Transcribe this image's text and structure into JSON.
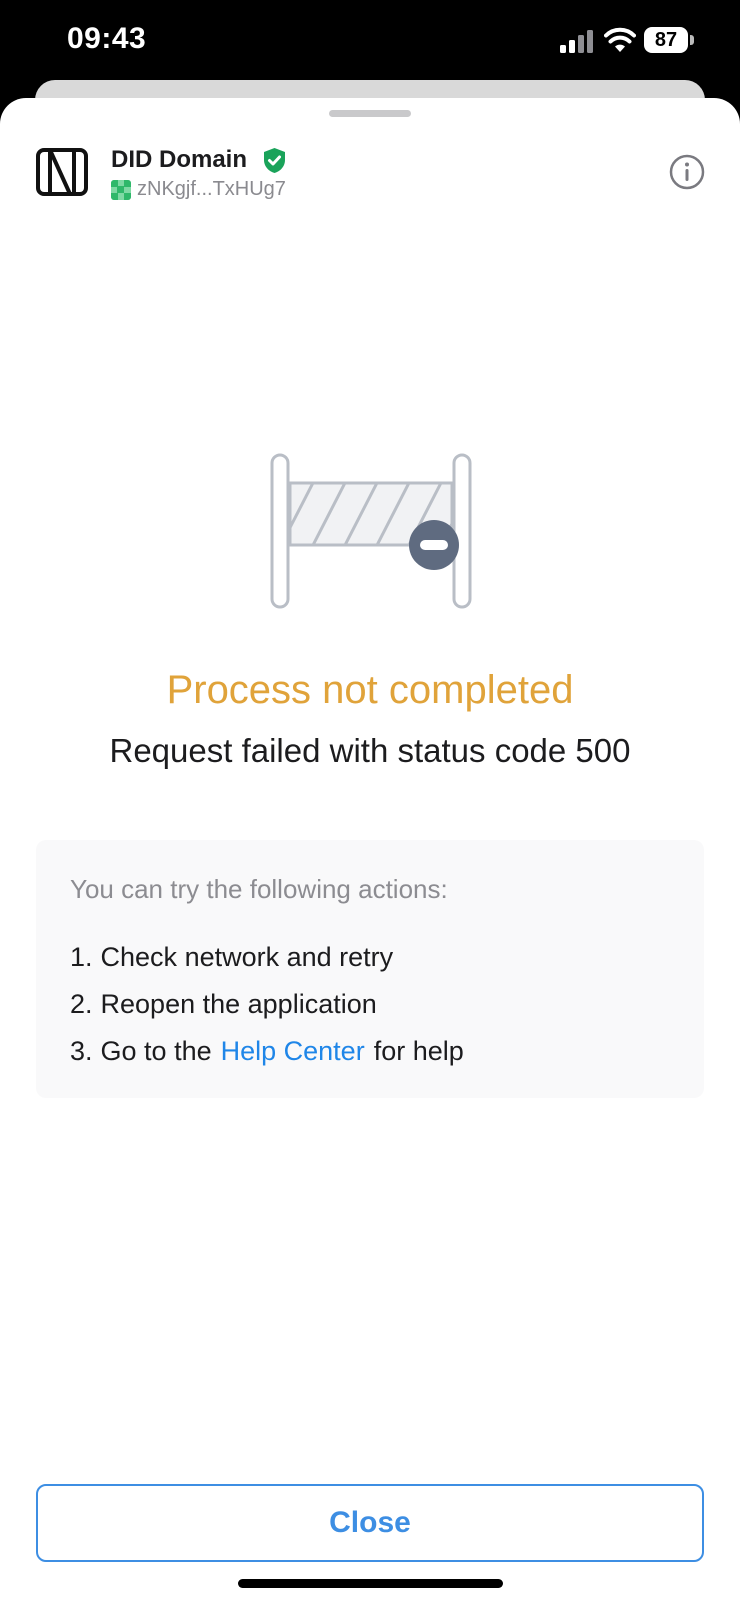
{
  "status_bar": {
    "time": "09:43",
    "battery": "87"
  },
  "header": {
    "title": "DID Domain",
    "address": "zNKgjf...TxHUg7"
  },
  "error": {
    "title": "Process not completed",
    "message": "Request failed with status code 500"
  },
  "actions": {
    "heading": "You can try the following actions:",
    "items": [
      {
        "number": "1.",
        "text": "Check network and retry"
      },
      {
        "number": "2.",
        "text": "Reopen the application"
      },
      {
        "number": "3.",
        "before": "Go to the",
        "link": "Help Center",
        "after": "for help"
      }
    ]
  },
  "footer": {
    "close_label": "Close"
  },
  "colors": {
    "error_title": "#e0a33a",
    "link": "#1f86e8",
    "verified": "#1aa35a",
    "button_border": "#3d8ee3"
  },
  "icons": {
    "logo": "did-domain-logo-icon",
    "verified": "verified-shield-icon",
    "info": "info-circle-icon",
    "illustration": "barrier-blocked-icon"
  }
}
